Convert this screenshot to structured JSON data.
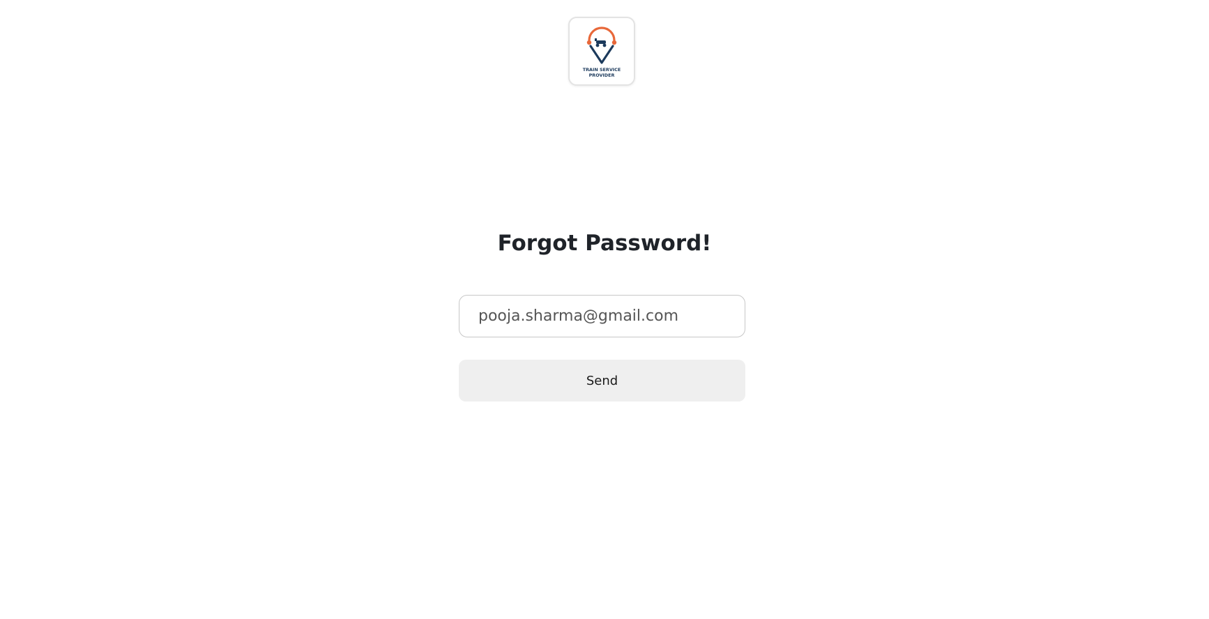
{
  "logo": {
    "text_line1": "TRAIN SERVICE",
    "text_line2": "PROVIDER",
    "colors": {
      "orange": "#e8683a",
      "navy": "#1c3a5c"
    }
  },
  "form": {
    "title": "Forgot Password!",
    "email_value": "pooja.sharma@gmail.com",
    "send_label": "Send"
  }
}
